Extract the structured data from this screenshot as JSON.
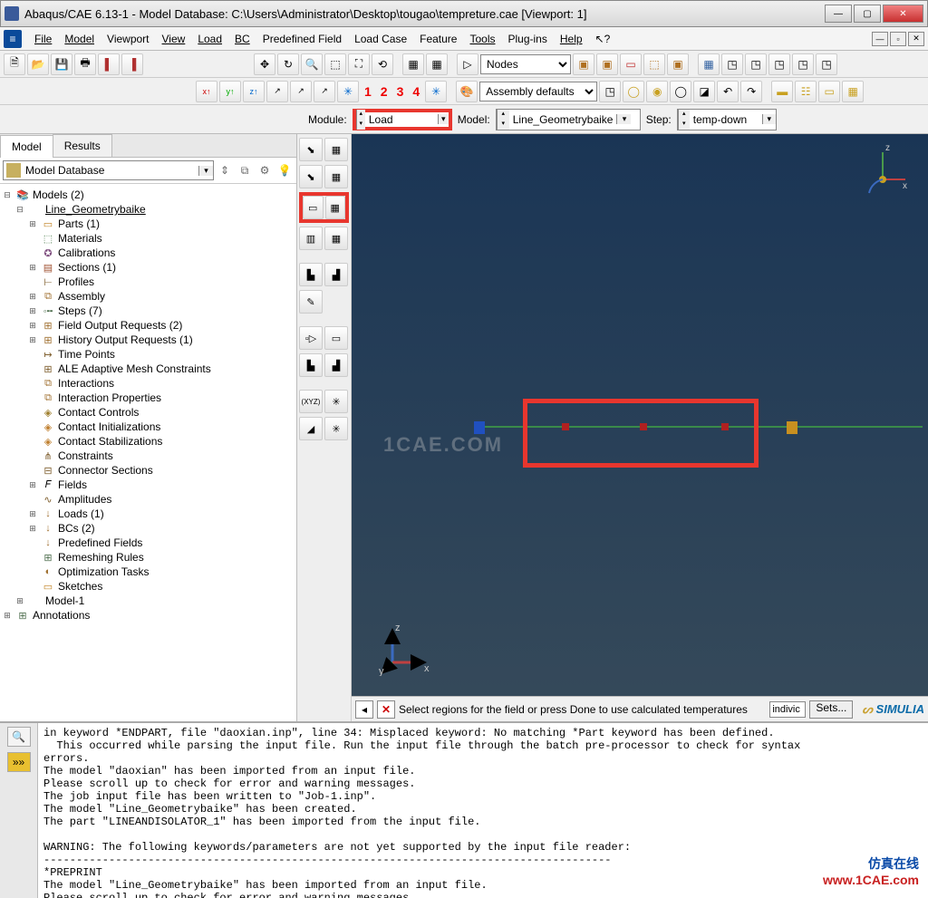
{
  "title": "Abaqus/CAE 6.13-1 - Model Database: C:\\Users\\Administrator\\Desktop\\tougao\\tempreture.cae [Viewport: 1]",
  "menus": [
    "File",
    "Model",
    "Viewport",
    "View",
    "Load",
    "BC",
    "Predefined Field",
    "Load Case",
    "Feature",
    "Tools",
    "Plug-ins",
    "Help"
  ],
  "combo_nodes": "Nodes",
  "combo_assembly": "Assembly defaults",
  "red_nums": [
    "1",
    "2",
    "3",
    "4"
  ],
  "context": {
    "module_label": "Module:",
    "module_value": "Load",
    "model_label": "Model:",
    "model_value": "Line_Geometrybaike",
    "step_label": "Step:",
    "step_value": "temp-down"
  },
  "tabs": {
    "model": "Model",
    "results": "Results"
  },
  "panel_combo": "Model Database",
  "tree": [
    {
      "i": 0,
      "exp": "⊟",
      "icon": "📚",
      "color": "#a07030",
      "label": "Models (2)"
    },
    {
      "i": 1,
      "exp": "⊟",
      "icon": "",
      "color": "",
      "label": "Line_Geometrybaike",
      "ul": true
    },
    {
      "i": 2,
      "exp": "⊞",
      "icon": "▭",
      "color": "#c08020",
      "label": "Parts (1)"
    },
    {
      "i": 2,
      "exp": "",
      "icon": "⬚",
      "color": "#508050",
      "label": "Materials"
    },
    {
      "i": 2,
      "exp": "",
      "icon": "✪",
      "color": "#805080",
      "label": "Calibrations"
    },
    {
      "i": 2,
      "exp": "⊞",
      "icon": "▤",
      "color": "#a05030",
      "label": "Sections (1)"
    },
    {
      "i": 2,
      "exp": "",
      "icon": "⊢",
      "color": "#806030",
      "label": "Profiles"
    },
    {
      "i": 2,
      "exp": "⊞",
      "icon": "⧉",
      "color": "#a07030",
      "label": "Assembly"
    },
    {
      "i": 2,
      "exp": "⊞",
      "icon": "◦╍",
      "color": "#507050",
      "label": "Steps (7)"
    },
    {
      "i": 2,
      "exp": "⊞",
      "icon": "⊞",
      "color": "#a07030",
      "label": "Field Output Requests (2)"
    },
    {
      "i": 2,
      "exp": "⊞",
      "icon": "⊞",
      "color": "#a07030",
      "label": "History Output Requests (1)"
    },
    {
      "i": 2,
      "exp": "",
      "icon": "↦",
      "color": "#806030",
      "label": "Time Points"
    },
    {
      "i": 2,
      "exp": "",
      "icon": "⊞",
      "color": "#806030",
      "label": "ALE Adaptive Mesh Constraints"
    },
    {
      "i": 2,
      "exp": "",
      "icon": "⧉",
      "color": "#a07030",
      "label": "Interactions"
    },
    {
      "i": 2,
      "exp": "",
      "icon": "⧉",
      "color": "#a07030",
      "label": "Interaction Properties"
    },
    {
      "i": 2,
      "exp": "",
      "icon": "◈",
      "color": "#a08030",
      "label": "Contact Controls"
    },
    {
      "i": 2,
      "exp": "",
      "icon": "◈",
      "color": "#c08030",
      "label": "Contact Initializations"
    },
    {
      "i": 2,
      "exp": "",
      "icon": "◈",
      "color": "#c08030",
      "label": "Contact Stabilizations"
    },
    {
      "i": 2,
      "exp": "",
      "icon": "⋔",
      "color": "#806030",
      "label": "Constraints"
    },
    {
      "i": 2,
      "exp": "",
      "icon": "⊟",
      "color": "#806030",
      "label": "Connector Sections"
    },
    {
      "i": 2,
      "exp": "⊞",
      "icon": "𝐹",
      "color": "#000",
      "label": "Fields"
    },
    {
      "i": 2,
      "exp": "",
      "icon": "∿",
      "color": "#806030",
      "label": "Amplitudes"
    },
    {
      "i": 2,
      "exp": "⊞",
      "icon": "↓",
      "color": "#a07030",
      "label": "Loads (1)"
    },
    {
      "i": 2,
      "exp": "⊞",
      "icon": "↓",
      "color": "#a07030",
      "label": "BCs (2)"
    },
    {
      "i": 2,
      "exp": "",
      "icon": "↓",
      "color": "#a07030",
      "label": "Predefined Fields"
    },
    {
      "i": 2,
      "exp": "",
      "icon": "⊞",
      "color": "#507050",
      "label": "Remeshing Rules"
    },
    {
      "i": 2,
      "exp": "",
      "icon": "◐",
      "color": "#a07030",
      "label": "Optimization Tasks"
    },
    {
      "i": 2,
      "exp": "",
      "icon": "▭",
      "color": "#c08020",
      "label": "Sketches"
    },
    {
      "i": 1,
      "exp": "⊞",
      "icon": "",
      "color": "",
      "label": "Model-1"
    },
    {
      "i": 0,
      "exp": "⊞",
      "icon": "⊞",
      "color": "#507050",
      "label": "Annotations"
    }
  ],
  "status": {
    "msg": "Select regions for the field or press Done to use calculated temperatures",
    "field": "indivic",
    "sets": "Sets...",
    "brand": "SIMULIA"
  },
  "console": "in keyword *ENDPART, file \"daoxian.inp\", line 34: Misplaced keyword: No matching *Part keyword has been defined.\n  This occurred while parsing the input file. Run the input file through the batch pre-processor to check for syntax\nerrors.\nThe model \"daoxian\" has been imported from an input file.\nPlease scroll up to check for error and warning messages.\nThe job input file has been written to \"Job-1.inp\".\nThe model \"Line_Geometrybaike\" has been created.\nThe part \"LINEANDISOLATOR_1\" has been imported from the input file.\n\nWARNING: The following keywords/parameters are not yet supported by the input file reader:\n---------------------------------------------------------------------------------------\n*PREPRINT\nThe model \"Line_Geometrybaike\" has been imported from an input file.\nPlease scroll up to check for error and warning messages.",
  "watermark": "1CAE.COM",
  "corner": {
    "cn": "仿真在线",
    "url": "www.1CAE.com"
  },
  "axes": {
    "x": "x",
    "y": "y",
    "z": "z"
  }
}
